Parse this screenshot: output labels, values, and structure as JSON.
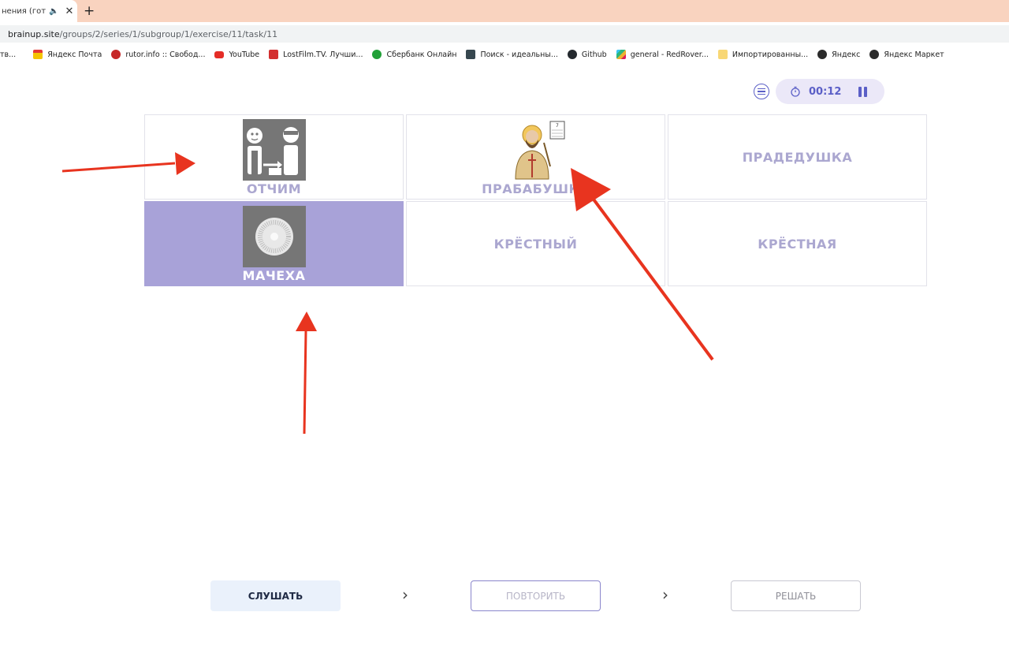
{
  "browser": {
    "tab_title": "нения (готов",
    "url_host": "brainup.site",
    "url_path": "/groups/2/series/1/subgroup/1/exercise/11/task/11",
    "bookmarks": [
      {
        "label": "тв...",
        "icon": "bookmark-icon"
      },
      {
        "label": "Яндекс Почта",
        "icon": "mail-icon"
      },
      {
        "label": "rutor.info :: Свобод...",
        "icon": "rutor-icon"
      },
      {
        "label": "YouTube",
        "icon": "youtube-icon"
      },
      {
        "label": "LostFilm.TV. Лучши...",
        "icon": "lostfilm-icon"
      },
      {
        "label": "Сбербанк Онлайн",
        "icon": "sberbank-icon"
      },
      {
        "label": "Поиск - идеальны...",
        "icon": "film-icon"
      },
      {
        "label": "Github",
        "icon": "github-icon"
      },
      {
        "label": "general - RedRover...",
        "icon": "slack-icon"
      },
      {
        "label": "Импортированны...",
        "icon": "folder-icon"
      },
      {
        "label": "Яндекс",
        "icon": "globe-icon"
      },
      {
        "label": "Яндекс Маркет",
        "icon": "globe-icon"
      }
    ]
  },
  "timer": {
    "time": "00:12"
  },
  "cards": [
    {
      "label": "ОТЧИМ",
      "image": "stepfather-pictogram",
      "selected": false
    },
    {
      "label": "ПРАБАБУШКА",
      "image": "saint-icon-picture",
      "selected": false
    },
    {
      "label": "ПРАДЕДУШКА",
      "image": null,
      "selected": false
    },
    {
      "label": "МАЧЕХА",
      "image": "stepmother-picture",
      "selected": true
    },
    {
      "label": "КРЁСТНЫЙ",
      "image": null,
      "selected": false
    },
    {
      "label": "КРЁСТНАЯ",
      "image": null,
      "selected": false
    }
  ],
  "actions": {
    "listen_label": "СЛУШАТЬ",
    "repeat_label": "ПОВТОРИТЬ",
    "solve_label": "РЕШАТЬ"
  },
  "colors": {
    "accent": "#5b5fc7",
    "selected_card": "#a8a2d8",
    "annotation_arrow": "#e8341f",
    "tabstrip": "#f9d3bf"
  }
}
